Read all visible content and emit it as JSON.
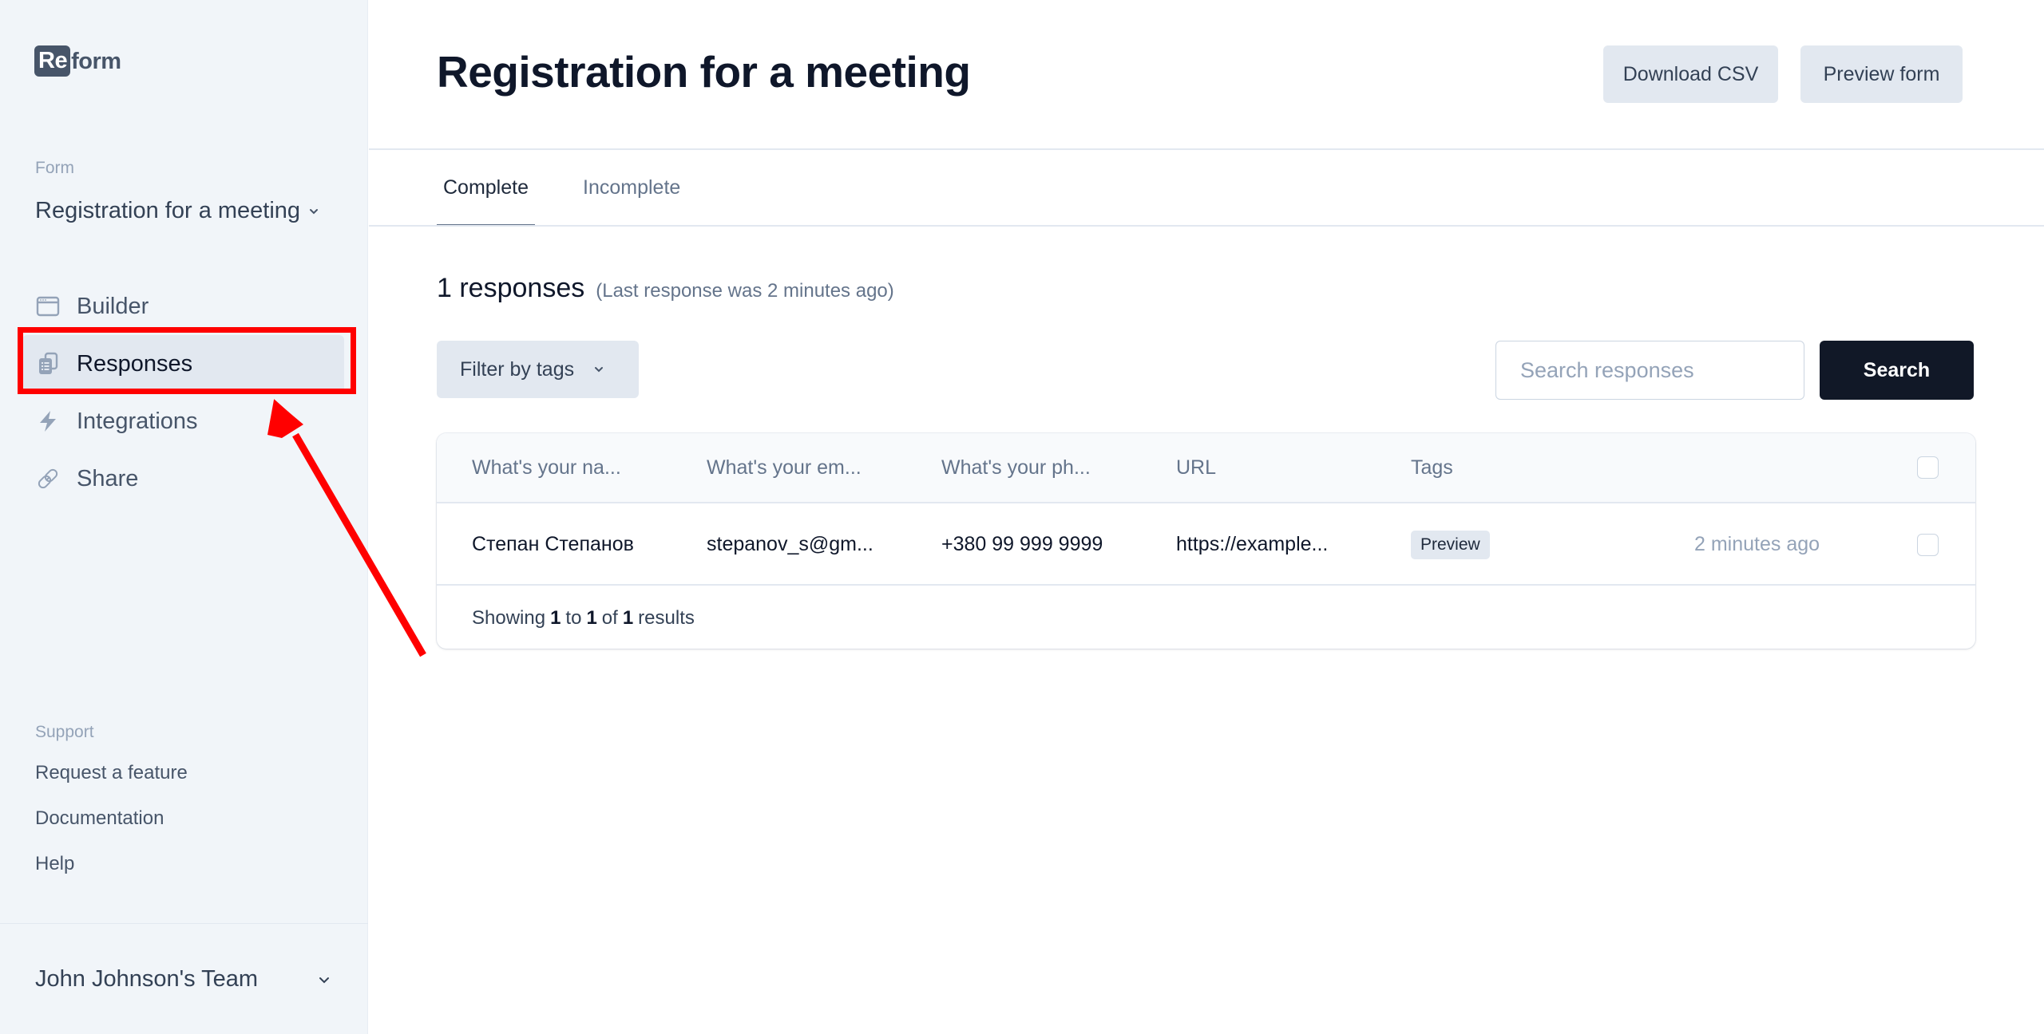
{
  "brand": {
    "badge": "Re",
    "rest": "form"
  },
  "sidebar": {
    "form_label": "Form",
    "form_name": "Registration for a meeting",
    "nav": [
      {
        "label": "Builder",
        "icon": "browser-window-icon",
        "active": false
      },
      {
        "label": "Responses",
        "icon": "documents-icon",
        "active": true
      },
      {
        "label": "Integrations",
        "icon": "lightning-bolt-icon",
        "active": false
      },
      {
        "label": "Share",
        "icon": "link-icon",
        "active": false
      }
    ],
    "support_label": "Support",
    "support_links": [
      "Request a feature",
      "Documentation",
      "Help"
    ],
    "team_name": "John Johnson's Team"
  },
  "header": {
    "title": "Registration for a meeting",
    "download_csv": "Download CSV",
    "preview_form": "Preview form"
  },
  "tabs": [
    {
      "label": "Complete",
      "active": true
    },
    {
      "label": "Incomplete",
      "active": false
    }
  ],
  "summary": {
    "count": "1 responses",
    "last": "(Last response was 2 minutes ago)"
  },
  "filter": {
    "label": "Filter by tags"
  },
  "search": {
    "placeholder": "Search responses",
    "value": "",
    "button": "Search"
  },
  "table": {
    "columns": [
      "What's your na...",
      "What's your em...",
      "What's your ph...",
      "URL",
      "Tags",
      ""
    ],
    "rows": [
      {
        "name": "Степан Степанов",
        "email": "stepanov_s@gm...",
        "phone": "+380 99 999 9999",
        "url": "https://example...",
        "tag": "Preview",
        "time": "2 minutes ago",
        "checked": false
      }
    ],
    "footer": {
      "prefix": "Showing",
      "from": "1",
      "to_word": "to",
      "to": "1",
      "of_word": "of",
      "total": "1",
      "suffix": "results"
    }
  },
  "colors": {
    "sidebar_bg": "#f1f5f9",
    "accent_dark": "#111827",
    "button_light": "#e2e8f0",
    "annotation": "#ff0000"
  }
}
